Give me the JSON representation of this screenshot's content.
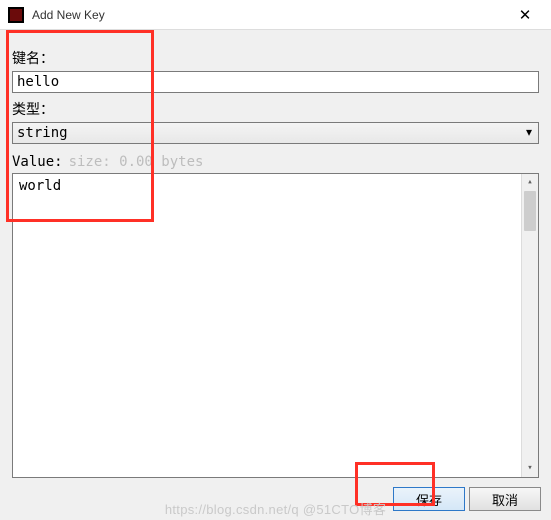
{
  "titlebar": {
    "icon_name": "app-icon",
    "title": "Add New Key",
    "close_glyph": "✕"
  },
  "labels": {
    "key_name": "键名：",
    "type": "类型：",
    "value": "Value:",
    "value_hint": "size: 0.00 bytes"
  },
  "fields": {
    "key_name_value": "hello",
    "type_selected": "string",
    "value_text": "world"
  },
  "buttons": {
    "save": "保存",
    "cancel": "取消"
  },
  "watermark": "https://blog.csdn.net/q @51CTO博客"
}
